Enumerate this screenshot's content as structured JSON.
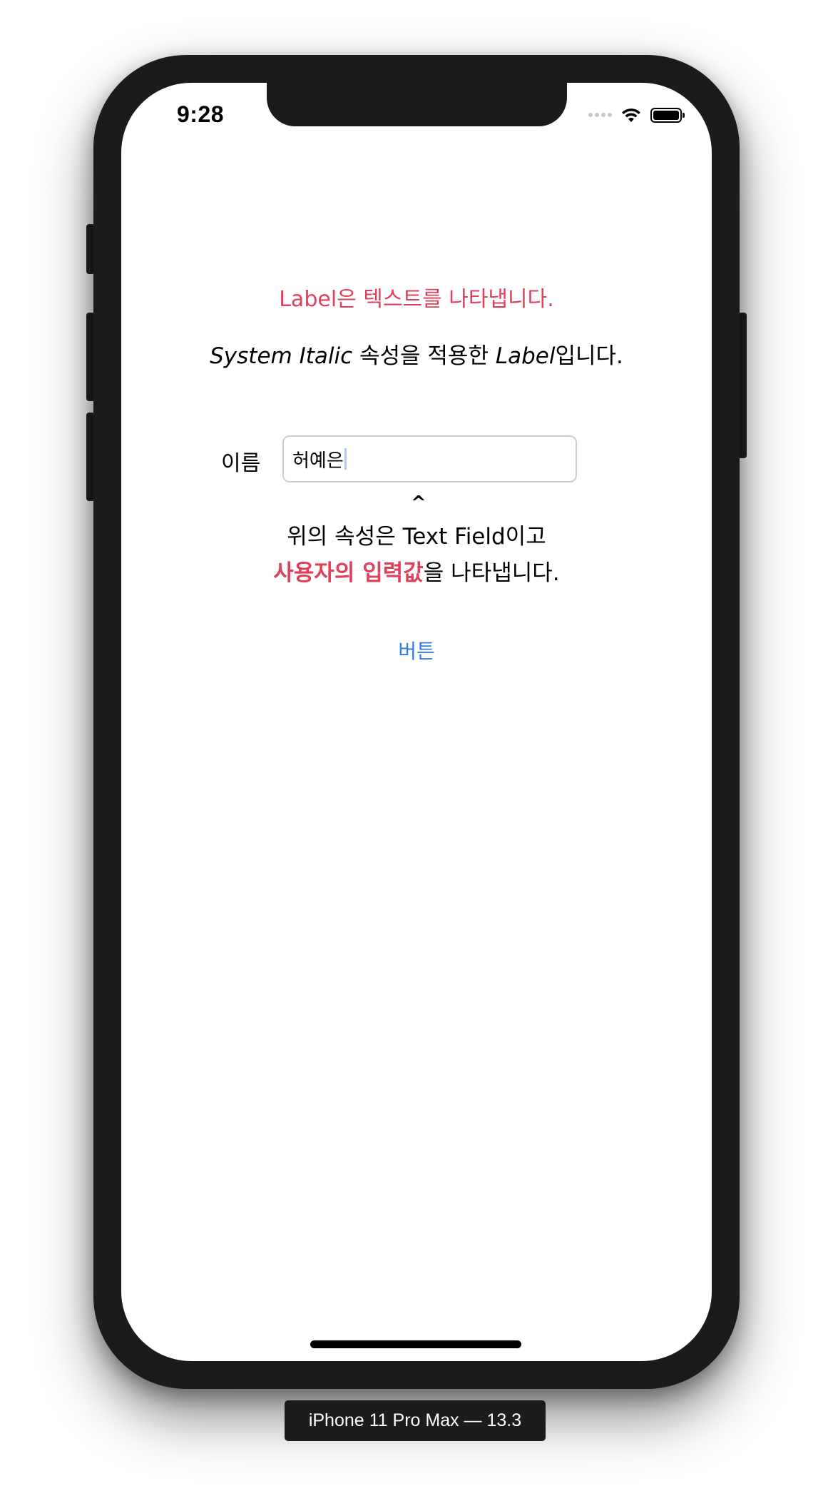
{
  "status_bar": {
    "time": "9:28"
  },
  "content": {
    "red_label": "Label은 텍스트를 나타냅니다.",
    "italic_label": {
      "part1_italic": "System Italic",
      "part2": " 속성을 적용한 ",
      "part3_italic": "Label",
      "part4": "입니다."
    },
    "name_label": "이름",
    "text_field_value": "허예은",
    "caret_mark": "^",
    "description_line1": "위의 속성은 Text Field이고",
    "description_line2": {
      "emphasis": "사용자의 입력값",
      "rest": "을 나타냅니다."
    },
    "button_label": "버튼"
  },
  "device_caption": "iPhone 11 Pro Max — 13.3",
  "colors": {
    "accent_red": "#e0415a",
    "button_blue": "#2f7de1",
    "device_frame": "#1b1b1c"
  }
}
